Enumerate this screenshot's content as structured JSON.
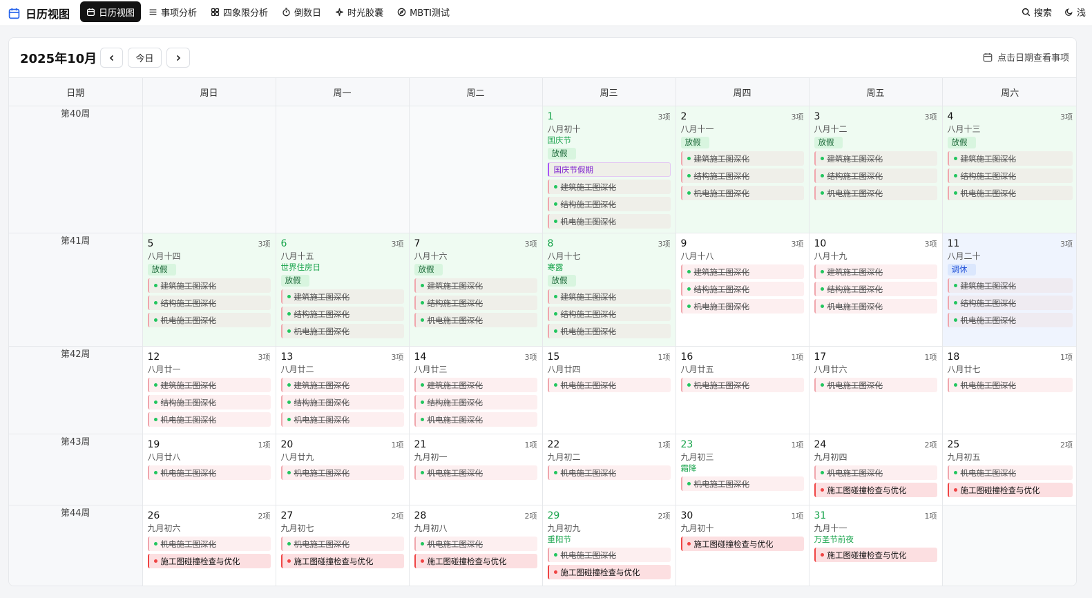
{
  "app": {
    "title": "日历视图"
  },
  "nav": [
    {
      "key": "calendar",
      "label": "日历视图",
      "icon": "calendar-icon",
      "active": true
    },
    {
      "key": "analysis",
      "label": "事项分析",
      "icon": "list-icon"
    },
    {
      "key": "quadrant",
      "label": "四象限分析",
      "icon": "grid-icon"
    },
    {
      "key": "countdown",
      "label": "倒数日",
      "icon": "timer-icon"
    },
    {
      "key": "capsule",
      "label": "时光胶囊",
      "icon": "sparkle-icon"
    },
    {
      "key": "mbti",
      "label": "MBTI测试",
      "icon": "compass-icon"
    }
  ],
  "top_right": {
    "search": "搜索",
    "theme_clip": "浅"
  },
  "header": {
    "month_title": "2025年10月",
    "prev": "‹",
    "today": "今日",
    "next": "›",
    "hint": "点击日期查看事项"
  },
  "columns": [
    "日期",
    "周日",
    "周一",
    "周二",
    "周三",
    "周四",
    "周五",
    "周六"
  ],
  "event_titles": {
    "a": "建筑施工图深化",
    "b": "结构施工图深化",
    "c": "机电施工图深化",
    "d": "施工图碰撞检查与优化",
    "p": "国庆节假期"
  },
  "weeks": [
    {
      "label": "第40周",
      "days": [
        null,
        null,
        null,
        {
          "num": "1",
          "green": true,
          "count": "3项",
          "lunar": "八月初十",
          "fest": "国庆节",
          "tag": "放假",
          "type": "holiday",
          "events": [
            "p",
            "a",
            "b",
            "c"
          ]
        },
        {
          "num": "2",
          "count": "3项",
          "lunar": "八月十一",
          "tag": "放假",
          "type": "holiday",
          "events": [
            "a",
            "b",
            "c"
          ]
        },
        {
          "num": "3",
          "count": "3项",
          "lunar": "八月十二",
          "tag": "放假",
          "type": "holiday",
          "events": [
            "a",
            "b",
            "c"
          ]
        },
        {
          "num": "4",
          "count": "3项",
          "lunar": "八月十三",
          "tag": "放假",
          "type": "holiday",
          "events": [
            "a",
            "b",
            "c"
          ]
        }
      ]
    },
    {
      "label": "第41周",
      "days": [
        {
          "num": "5",
          "count": "3项",
          "lunar": "八月十四",
          "tag": "放假",
          "type": "holiday",
          "events": [
            "a",
            "b",
            "c"
          ]
        },
        {
          "num": "6",
          "green": true,
          "count": "3项",
          "lunar": "八月十五",
          "fest": "世界住房日",
          "tag": "放假",
          "type": "holiday",
          "events": [
            "a",
            "b",
            "c"
          ]
        },
        {
          "num": "7",
          "count": "3项",
          "lunar": "八月十六",
          "tag": "放假",
          "type": "holiday",
          "events": [
            "a",
            "b",
            "c"
          ]
        },
        {
          "num": "8",
          "green": true,
          "count": "3项",
          "lunar": "八月十七",
          "fest": "寒露",
          "tag": "放假",
          "type": "holiday",
          "events": [
            "a",
            "b",
            "c"
          ]
        },
        {
          "num": "9",
          "count": "3项",
          "lunar": "八月十八",
          "events": [
            "a",
            "b",
            "c"
          ]
        },
        {
          "num": "10",
          "count": "3项",
          "lunar": "八月十九",
          "events": [
            "a",
            "b",
            "c"
          ]
        },
        {
          "num": "11",
          "count": "3项",
          "lunar": "八月二十",
          "tag": "调休",
          "type": "workday",
          "events": [
            "a",
            "b",
            "c"
          ]
        }
      ]
    },
    {
      "label": "第42周",
      "days": [
        {
          "num": "12",
          "count": "3项",
          "lunar": "八月廿一",
          "events": [
            "a",
            "b",
            "c"
          ]
        },
        {
          "num": "13",
          "count": "3项",
          "lunar": "八月廿二",
          "events": [
            "a",
            "b",
            "c"
          ]
        },
        {
          "num": "14",
          "count": "3项",
          "lunar": "八月廿三",
          "events": [
            "a",
            "b",
            "c"
          ]
        },
        {
          "num": "15",
          "count": "1项",
          "lunar": "八月廿四",
          "events": [
            "c"
          ]
        },
        {
          "num": "16",
          "count": "1项",
          "lunar": "八月廿五",
          "events": [
            "c"
          ]
        },
        {
          "num": "17",
          "count": "1项",
          "lunar": "八月廿六",
          "events": [
            "c"
          ]
        },
        {
          "num": "18",
          "count": "1项",
          "lunar": "八月廿七",
          "events": [
            "c"
          ]
        }
      ]
    },
    {
      "label": "第43周",
      "days": [
        {
          "num": "19",
          "count": "1项",
          "lunar": "八月廿八",
          "events": [
            "c"
          ]
        },
        {
          "num": "20",
          "count": "1项",
          "lunar": "八月廿九",
          "events": [
            "c"
          ]
        },
        {
          "num": "21",
          "count": "1项",
          "lunar": "九月初一",
          "events": [
            "c"
          ]
        },
        {
          "num": "22",
          "count": "1项",
          "lunar": "九月初二",
          "events": [
            "c"
          ]
        },
        {
          "num": "23",
          "green": true,
          "count": "1项",
          "lunar": "九月初三",
          "fest": "霜降",
          "events": [
            "c"
          ]
        },
        {
          "num": "24",
          "count": "2项",
          "lunar": "九月初四",
          "events": [
            "c",
            "d"
          ]
        },
        {
          "num": "25",
          "count": "2项",
          "lunar": "九月初五",
          "events": [
            "c",
            "d"
          ]
        }
      ]
    },
    {
      "label": "第44周",
      "days": [
        {
          "num": "26",
          "count": "2项",
          "lunar": "九月初六",
          "events": [
            "c",
            "d"
          ]
        },
        {
          "num": "27",
          "count": "2项",
          "lunar": "九月初七",
          "events": [
            "c",
            "d"
          ]
        },
        {
          "num": "28",
          "count": "2项",
          "lunar": "九月初八",
          "events": [
            "c",
            "d"
          ]
        },
        {
          "num": "29",
          "green": true,
          "count": "2项",
          "lunar": "九月初九",
          "fest": "重阳节",
          "events": [
            "c",
            "d"
          ]
        },
        {
          "num": "30",
          "count": "1项",
          "lunar": "九月初十",
          "events": [
            "d"
          ]
        },
        {
          "num": "31",
          "green": true,
          "count": "1项",
          "lunar": "九月十一",
          "fest": "万圣节前夜",
          "events": [
            "d"
          ]
        },
        null
      ]
    }
  ],
  "colors": {
    "accent": "#2563eb",
    "holiday_bg": "#effbf2",
    "workday_bg": "#eff4fe",
    "green": "#16a34a",
    "red": "#ef4444"
  }
}
